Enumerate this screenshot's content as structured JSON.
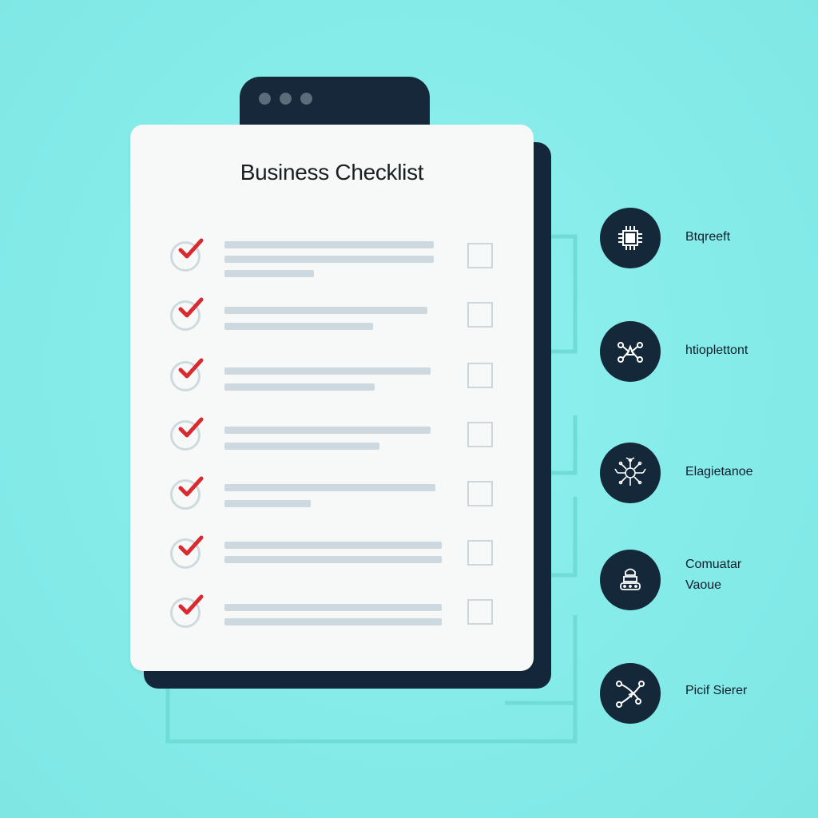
{
  "checklist": {
    "title": "Business Checklist",
    "items_checked": 7
  },
  "features": [
    {
      "icon": "chip-icon",
      "label": "Btqreeft"
    },
    {
      "icon": "network-nodes-icon",
      "label": "htioplettont"
    },
    {
      "icon": "neural-tree-icon",
      "label": "Elagietanoe"
    },
    {
      "icon": "server-stack-icon",
      "label_line1": "Comuatar",
      "label_line2": "Vaoue"
    },
    {
      "icon": "path-arrows-icon",
      "label": "Picif Sierer"
    }
  ],
  "colors": {
    "background": "#84ebe9",
    "card": "#f7f9f8",
    "dark": "#14283a",
    "check": "#d92b2f",
    "connector": "#6fdcd8"
  }
}
